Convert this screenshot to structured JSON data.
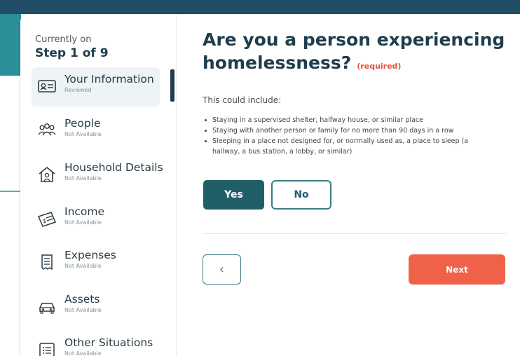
{
  "sidebar": {
    "step_label": "Currently on",
    "step_count": "Step 1 of 9",
    "items": [
      {
        "label": "Your Information",
        "status": "Reviewed",
        "icon": "id-card-icon"
      },
      {
        "label": "People",
        "status": "Not Available",
        "icon": "people-icon"
      },
      {
        "label": "Household Details",
        "status": "Not Available",
        "icon": "house-icon"
      },
      {
        "label": "Income",
        "status": "Not Available",
        "icon": "money-icon"
      },
      {
        "label": "Expenses",
        "status": "Not Available",
        "icon": "receipt-icon"
      },
      {
        "label": "Assets",
        "status": "Not Available",
        "icon": "car-icon"
      },
      {
        "label": "Other Situations",
        "status": "Not Available",
        "icon": "list-icon"
      }
    ]
  },
  "question": {
    "title": "Are you a person experiencing homelessness?",
    "required": "(required)",
    "intro": "This could include:",
    "bullets": [
      "Staying in a supervised shelter, halfway house, or similar place",
      "Staying with another person or family for no more than 90 days in a row",
      "Sleeping in a place not designed for, or normally used as, a place to sleep (a hallway, a bus station, a lobby, or similar)"
    ],
    "yes_label": "Yes",
    "no_label": "No",
    "selected": "Yes"
  },
  "footer": {
    "back_icon": "chevron-left-icon",
    "back_glyph": "‹",
    "next_label": "Next"
  },
  "colors": {
    "primary": "#215f68",
    "heading": "#1e3d4d",
    "accent": "#ef6148",
    "connector": "#56b69a",
    "top_band": "#1f4e66"
  }
}
